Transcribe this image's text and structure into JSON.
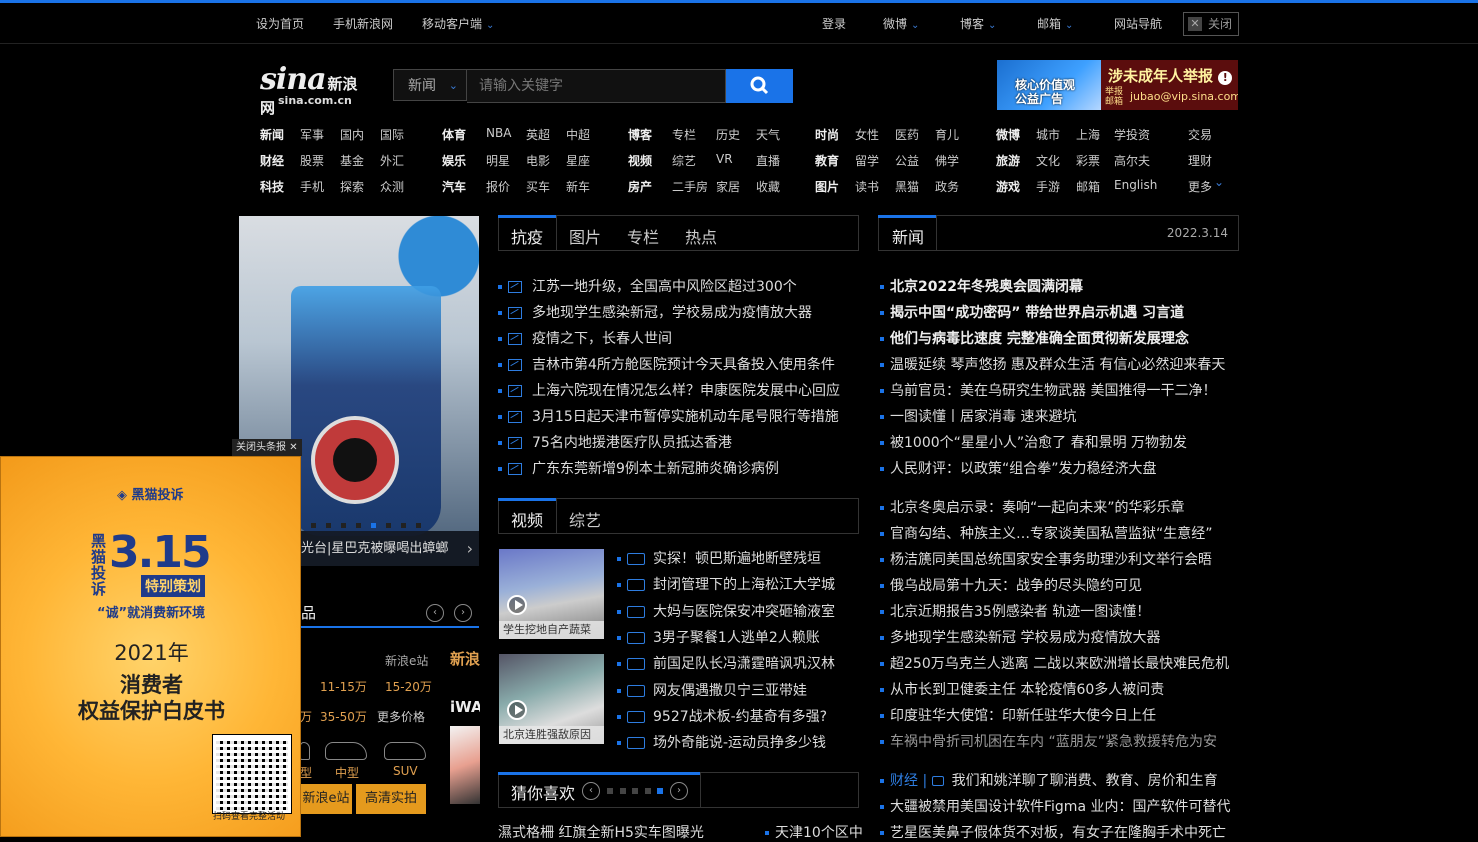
{
  "topbar": {
    "set_home": "设为首页",
    "mobile_sina": "手机新浪网",
    "mobile_client": "移动客户端",
    "login": "登录",
    "weibo": "微博",
    "blog": "博客",
    "mail": "邮箱",
    "site_nav": "网站导航",
    "close": "关闭"
  },
  "logo": {
    "brand": "sina",
    "brand_cn": "新浪网",
    "domain": "sina.com.cn"
  },
  "search": {
    "category": "新闻",
    "placeholder": "请输入关键字"
  },
  "ad_banner": {
    "left_text": "核心价值观\n公益广告",
    "title": "涉未成年人举报",
    "small": "举报邮箱",
    "email": "jubao@vip.sina.com"
  },
  "nav": {
    "group1": [
      [
        "新闻",
        "军事",
        "国内",
        "国际"
      ],
      [
        "财经",
        "股票",
        "基金",
        "外汇"
      ],
      [
        "科技",
        "手机",
        "探索",
        "众测"
      ]
    ],
    "group2": [
      [
        "体育",
        "NBA",
        "英超",
        "中超"
      ],
      [
        "娱乐",
        "明星",
        "电影",
        "星座"
      ],
      [
        "汽车",
        "报价",
        "买车",
        "新车"
      ]
    ],
    "group3": [
      [
        "博客",
        "专栏",
        "历史",
        "天气"
      ],
      [
        "视频",
        "综艺",
        "VR",
        "直播"
      ],
      [
        "房产",
        "二手房",
        "家居",
        "收藏"
      ]
    ],
    "group4": [
      [
        "时尚",
        "女性",
        "医药",
        "育儿"
      ],
      [
        "教育",
        "留学",
        "公益",
        "佛学"
      ],
      [
        "图片",
        "读书",
        "黑猫",
        "政务"
      ]
    ],
    "group5": [
      [
        "微博",
        "城市",
        "上海",
        "学投资"
      ],
      [
        "旅游",
        "文化",
        "彩票",
        "高尔夫"
      ],
      [
        "游戏",
        "手游",
        "邮箱",
        "English"
      ]
    ],
    "group6": [
      "交易",
      "理财",
      "更多"
    ]
  },
  "slideshow": {
    "caption": "光台|星巴克被曝喝出蟑螂",
    "dots_total": 8,
    "active_dot": 4
  },
  "below_slide": {
    "header": "品",
    "ecar": "新浪e站",
    "prices_row1": [
      "11-15万",
      "15-20万"
    ],
    "prices_row2": [
      "万",
      "35-50万",
      "更多价格"
    ],
    "car_types": [
      "型",
      "中型",
      "SUV"
    ],
    "buttons": [
      "新浪e站",
      "高清实拍"
    ],
    "strip_title": "新浪",
    "strip_sub": "iWA"
  },
  "popup": {
    "close_label": "关闭头条报",
    "brand": "黑猫投诉",
    "vertical": "黑猫投诉",
    "number": "3.15",
    "plan": "特别策划",
    "slogan": "“诚”就消费新环境",
    "year": "2021年",
    "title1": "消费者",
    "title2": "权益保护白皮书",
    "qr_caption": "扫码查看完整活动"
  },
  "mid_tabs": [
    "抗疫",
    "图片",
    "专栏",
    "热点"
  ],
  "mid_news": [
    "江苏一地升级，全国高中风险区超过300个",
    "多地现学生感染新冠，学校易成为疫情放大器",
    "疫情之下，长春人世间",
    "吉林市第4所方舱医院预计今天具备投入使用条件",
    "上海六院现在情况怎么样？申康医院发展中心回应",
    "3月15日起天津市暂停实施机动车尾号限行等措施",
    "75名内地援港医疗队员抵达香港",
    "广东东莞新增9例本土新冠肺炎确诊病例"
  ],
  "video_tabs": [
    "视频",
    "综艺"
  ],
  "video_thumbs": [
    "学生挖地自产蔬菜",
    "北京连胜强敌原因"
  ],
  "video_news": [
    "实探！顿巴斯遍地断壁残垣",
    "封闭管理下的上海松江大学城",
    "大妈与医院保安冲突砸输液室",
    "3男子聚餐1人逃单2人赖账",
    "前国足队长冯潇霆暗讽巩汉林",
    "网友偶遇撒贝宁三亚带娃",
    "9527战术板-约基奇有多强?",
    "场外奇能说-运动员挣多少钱"
  ],
  "guess": {
    "title": "猜你喜欢",
    "dots_total": 5,
    "active_dot": 4,
    "items": [
      "濕式格柵 红旗全新H5实车图曝光",
      "天津10个区中"
    ]
  },
  "right": {
    "tab": "新闻",
    "date": "2022.3.14",
    "bold_news": [
      "北京2022年冬残奥会圆满闭幕",
      "揭示中国“成功密码” 带给世界启示机遇 习言道",
      "他们与病毒比速度 完整准确全面贯彻新发展理念"
    ],
    "news1": [
      "温暖延续 琴声悠扬 惠及群众生活 有信心必然迎来春天",
      "乌前官员：美在乌研究生物武器 美国推得一干二净！",
      "一图读懂丨居家消毒 速来避坑",
      "被1000个“星星小人”治愈了 春和景明 万物勃发",
      "人民财评：以政策“组合拳”发力稳经济大盘"
    ],
    "news2": [
      "北京冬奥启示录：奏响“一起向未来”的华彩乐章",
      "官商勾结、种族主义…专家谈美国私营监狱“生意经”",
      "杨洁篪同美国总统国家安全事务助理沙利文举行会晤",
      "俄乌战局第十九天：战争的尽头隐约可见",
      "北京近期报告35例感染者 轨迹一图读懂！",
      "多地现学生感染新冠 学校易成为疫情放大器",
      "超250万乌克兰人逃离 二战以来欧洲增长最快难民危机",
      "从市长到卫健委主任 本轮疫情60多人被问责",
      "印度驻华大使馆：印新任驻华大使今日上任",
      "车祸中骨折司机困在车内 “蓝朋友”紧急救援转危为安"
    ],
    "finance_label": "财经 |",
    "finance_news": "我们和姚洋聊了聊消费、教育、房价和生育",
    "news3": [
      "大疆被禁用美国设计软件Figma 业内：国产软件可替代",
      "艺星医美鼻子假体货不对板，有女子在隆胸手术中死亡"
    ]
  }
}
